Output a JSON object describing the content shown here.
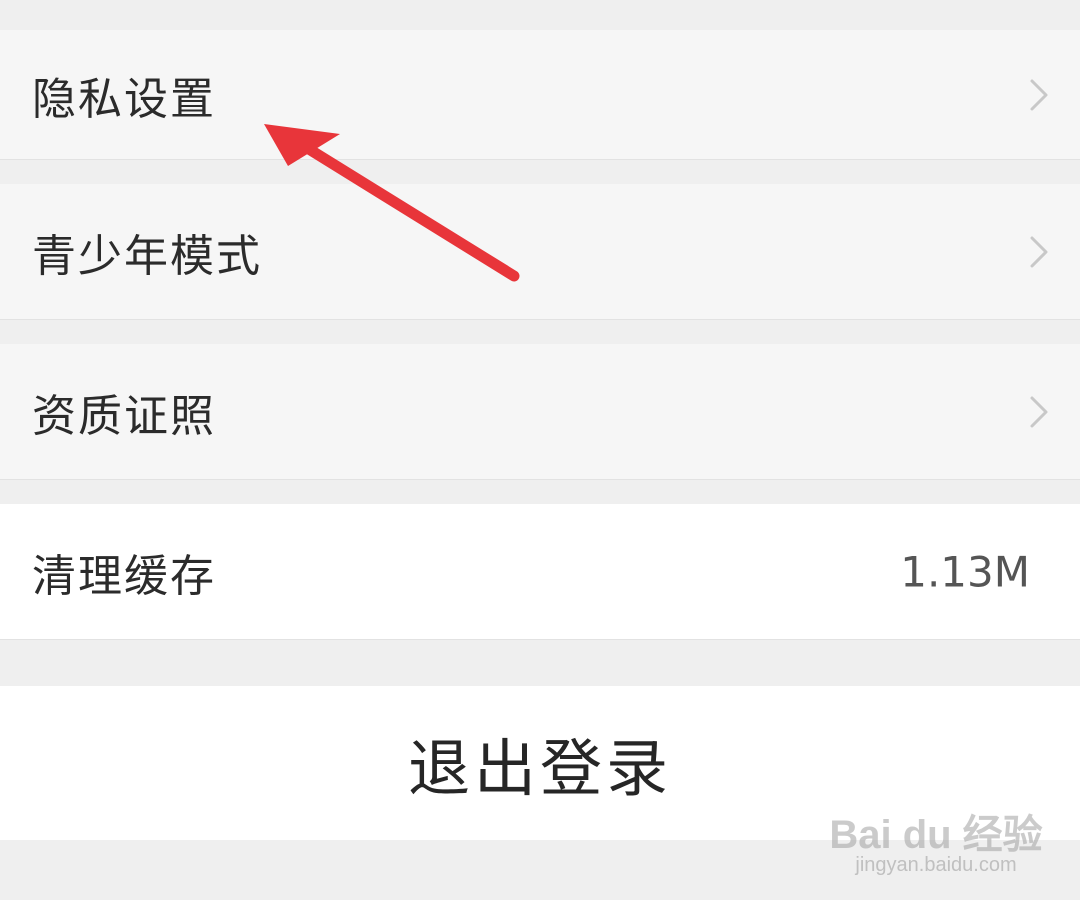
{
  "settings": {
    "items": [
      {
        "label": "隐私设置",
        "chevron": "chevron-right-icon"
      },
      {
        "label": "青少年模式",
        "chevron": "chevron-right-icon"
      },
      {
        "label": "资质证照",
        "chevron": "chevron-right-icon"
      },
      {
        "label": "清理缓存",
        "value": "1.13M"
      }
    ]
  },
  "logout": {
    "label": "退出登录"
  },
  "annotation": {
    "icon": "red-arrow-icon",
    "color": "#e8353a"
  },
  "watermark": {
    "brand": "Bai du 经验",
    "url": "jingyan.baidu.com"
  },
  "colors": {
    "background": "#efefef",
    "row": "#f6f6f6",
    "white": "#ffffff",
    "text": "#2b2b2b",
    "chevron": "#c8c8c8"
  }
}
